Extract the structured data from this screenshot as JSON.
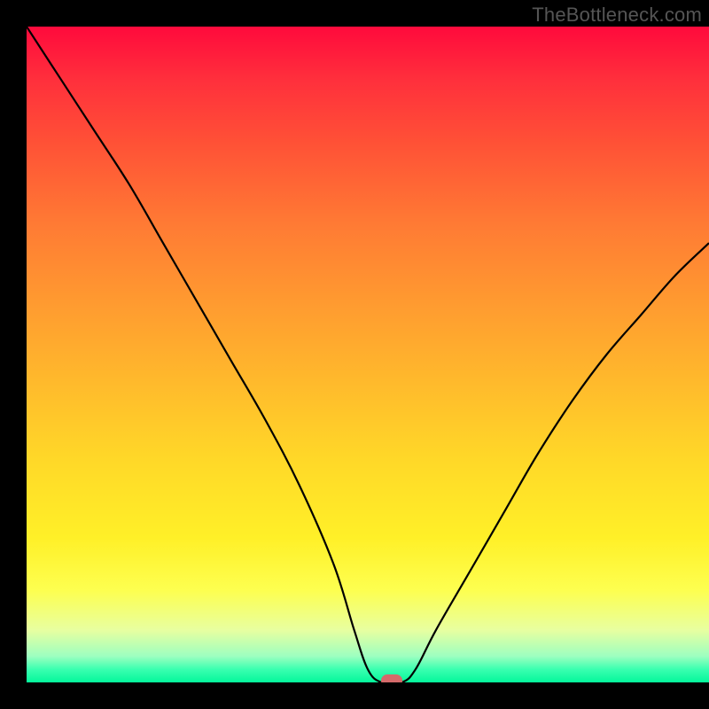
{
  "watermark": "TheBottleneck.com",
  "chart_data": {
    "type": "line",
    "title": "",
    "xlabel": "",
    "ylabel": "",
    "xlim": [
      0,
      100
    ],
    "ylim": [
      0,
      100
    ],
    "x": [
      0,
      5,
      10,
      15,
      20,
      25,
      30,
      35,
      40,
      45,
      48,
      50,
      52,
      55,
      57,
      60,
      65,
      70,
      75,
      80,
      85,
      90,
      95,
      100
    ],
    "y": [
      100,
      92,
      84,
      76,
      67,
      58,
      49,
      40,
      30,
      18,
      8,
      2,
      0,
      0,
      2,
      8,
      17,
      26,
      35,
      43,
      50,
      56,
      62,
      67
    ],
    "marker": {
      "x": 53.5,
      "y": 0
    },
    "gradient_stops": [
      {
        "pos": 0,
        "color": "#ff0a3c"
      },
      {
        "pos": 50,
        "color": "#ffb92c"
      },
      {
        "pos": 85,
        "color": "#fdff50"
      },
      {
        "pos": 100,
        "color": "#04f79b"
      }
    ]
  }
}
